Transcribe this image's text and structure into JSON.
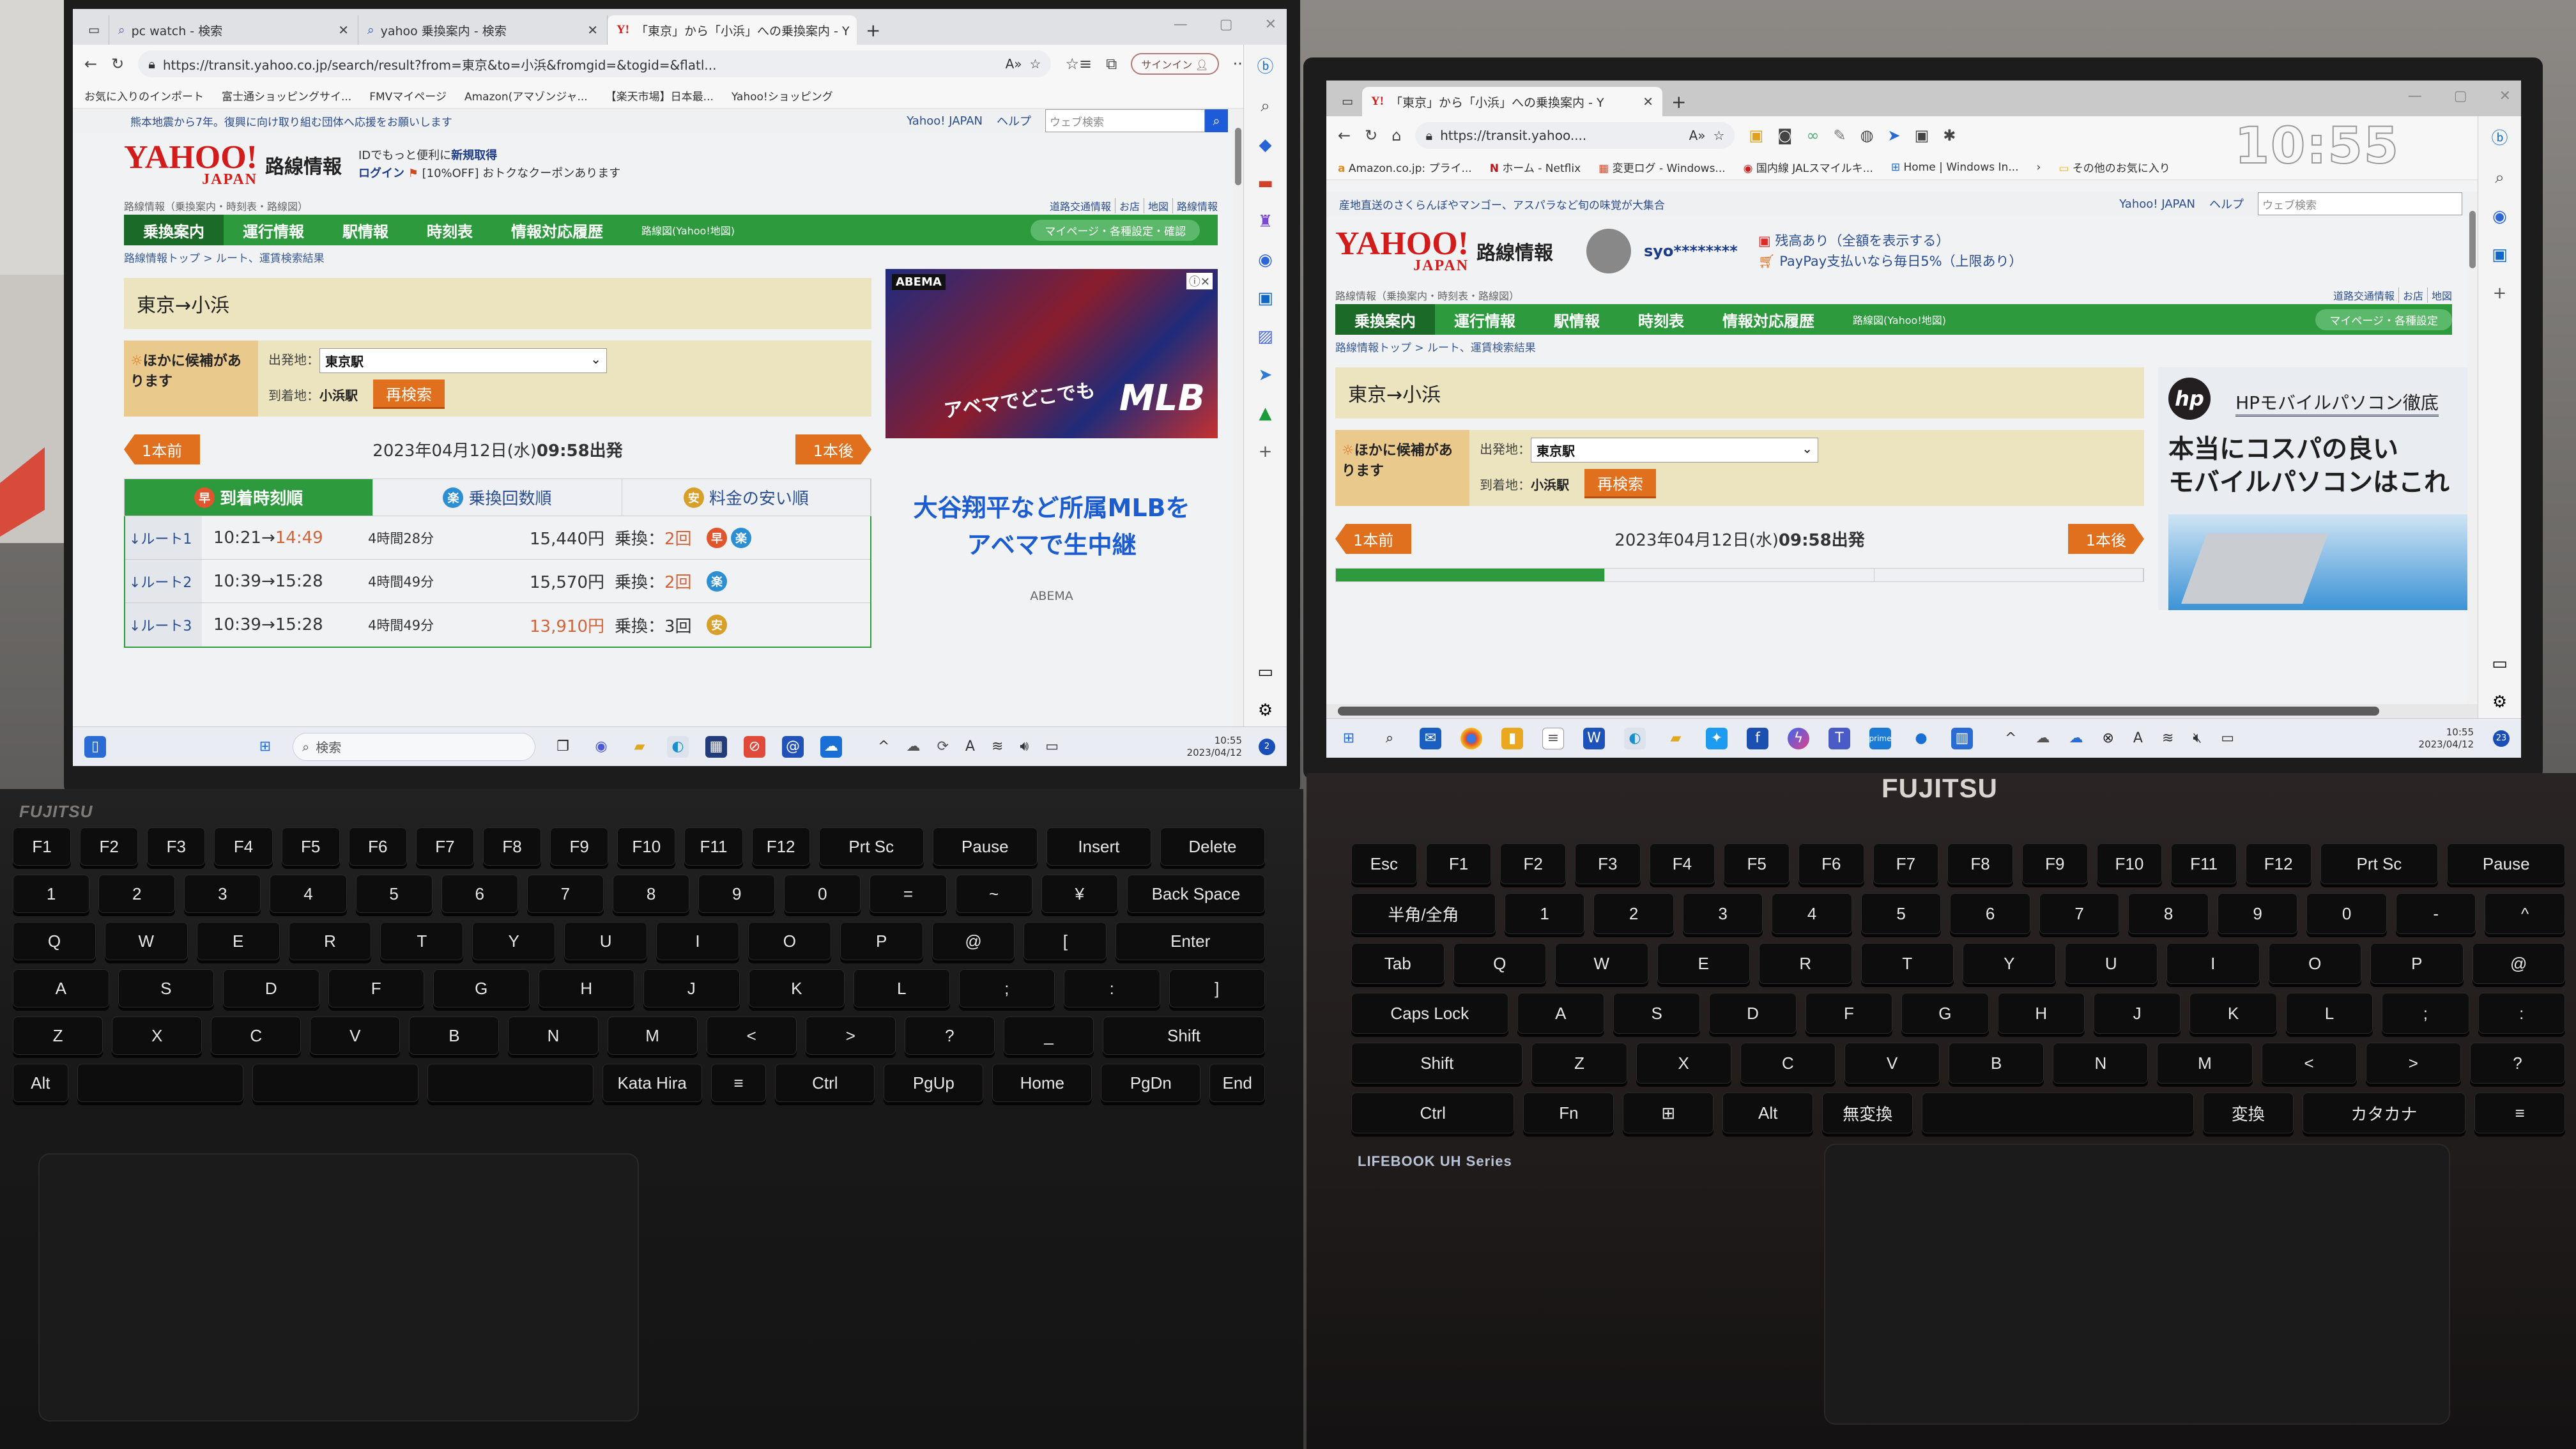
{
  "left_laptop": {
    "brand": "FUJITSU",
    "browser": {
      "tabs": [
        {
          "icon": "search-icon",
          "title": "pc watch - 検索"
        },
        {
          "icon": "search-icon",
          "title": "yahoo 乗換案内 - 検索"
        },
        {
          "icon": "yahoo-icon",
          "title": "「東京」から「小浜」への乗換案内 - Y",
          "active": true
        }
      ],
      "new_tab": "+",
      "address": "https://transit.yahoo.co.jp/search/result?from=東京&to=小浜&fromgid=&togid=&flatl...",
      "signin_label": "サインイン",
      "more": "···",
      "favorites": [
        "お気に入りのインポート",
        "富士通ショッピングサイ...",
        "FMVマイページ",
        "Amazon(アマゾンジャ...",
        "【楽天市場】日本最...",
        "Yahoo!ショッピング"
      ]
    },
    "page": {
      "promo": "熊本地震から7年。復興に向け取り組む団体へ応援をお願いします",
      "top_links": [
        "Yahoo! JAPAN",
        "ヘルプ"
      ],
      "search_placeholder": "ウェブ検索",
      "logo_main": "YAHOO!",
      "logo_sub": "JAPAN",
      "service_name": "路線情報",
      "id_text": "IDでもっと便利に",
      "id_link": "新規取得",
      "login": "ログイン",
      "coupon": "[10%OFF] おトクなクーポンあります",
      "subtitle": "路線情報（乗換案内・時刻表・路線図）",
      "sub_links": [
        "道路交通情報",
        "お店",
        "地図",
        "路線情報"
      ],
      "nav": [
        "乗換案内",
        "運行情報",
        "駅情報",
        "時刻表",
        "情報対応履歴"
      ],
      "nav_small": "路線図(Yahoo!地図)",
      "mypage": "マイページ・各種設定・確認",
      "breadcrumb": "路線情報トップ > ルート、運賃検索結果",
      "route_title": "東京→小浜",
      "candidate_label": "ほかに候補があります",
      "from_label": "出発地：",
      "from_value": "東京駅",
      "to_label": "到着地：",
      "to_value": "小浜駅",
      "research": "再検索",
      "prev": "1本前",
      "next": "1本後",
      "date": "2023年04月12日(水)",
      "dep_time": "09:58出発",
      "sort_tabs": [
        {
          "badge": "早",
          "label": "到着時刻順",
          "active": true
        },
        {
          "badge": "楽",
          "label": "乗換回数順"
        },
        {
          "badge": "安",
          "label": "料金の安い順"
        }
      ],
      "routes": [
        {
          "name": "↓ルート1",
          "dep": "10:21",
          "arr": "14:49",
          "duration": "4時間28分",
          "fare": "15,440円",
          "transfers_label": "乗換：",
          "transfers": "2回",
          "badges": [
            "早",
            "楽"
          ]
        },
        {
          "name": "↓ルート2",
          "dep": "10:39",
          "arr": "15:28",
          "duration": "4時間49分",
          "fare": "15,570円",
          "transfers_label": "乗換：",
          "transfers": "2回",
          "badges": [
            "楽"
          ]
        },
        {
          "name": "↓ルート3",
          "dep": "10:39",
          "arr": "15:28",
          "duration": "4時間49分",
          "fare": "13,910円",
          "transfers_label": "乗換：",
          "transfers": "3回",
          "badges": [
            "安"
          ]
        }
      ],
      "ad": {
        "tag": "ABEMA",
        "catch": "アベマでどこでも",
        "big": "MLB",
        "text": "大谷翔平など所属MLBをアベマで生中継",
        "source": "ABEMA"
      }
    },
    "taskbar": {
      "search": "検索",
      "time": "10:55",
      "date": "2023/04/12",
      "notifications": "2"
    }
  },
  "right_laptop": {
    "brand": "FUJITSU",
    "model": "LIFEBOOK UH Series",
    "overlay_clock": "10:55",
    "browser": {
      "tabs": [
        {
          "icon": "yahoo-icon",
          "title": "「東京」から「小浜」への乗換案内 - Y",
          "active": true
        }
      ],
      "new_tab": "+",
      "address": "https://transit.yahoo....",
      "favorites": [
        "Amazon.co.jp: プライ...",
        "ホーム - Netflix",
        "変更ログ - Windows...",
        "国内線 JALスマイルキ...",
        "Home | Windows In..."
      ],
      "other_favorites": "その他のお気に入り"
    },
    "page": {
      "promo": "産地直送のさくらんぼやマンゴー、アスパラなど旬の味覚が大集合",
      "top_links": [
        "Yahoo! JAPAN",
        "ヘルプ"
      ],
      "search_placeholder": "ウェブ検索",
      "logo_main": "YAHOO!",
      "logo_sub": "JAPAN",
      "service_name": "路線情報",
      "username": "syo********",
      "balance": "残高あり（全額を表示する）",
      "paypay": "PayPay支払いなら毎日5%（上限あり）",
      "subtitle": "路線情報（乗換案内・時刻表・路線図）",
      "sub_links": [
        "道路交通情報",
        "お店",
        "地図"
      ],
      "nav": [
        "乗換案内",
        "運行情報",
        "駅情報",
        "時刻表",
        "情報対応履歴"
      ],
      "nav_small": "路線図(Yahoo!地図)",
      "mypage": "マイページ・各種設定",
      "breadcrumb": "路線情報トップ > ルート、運賃検索結果",
      "route_title": "東京→小浜",
      "candidate_label": "ほかに候補があります",
      "from_label": "出発地：",
      "from_value": "東京駅",
      "to_label": "到着地：",
      "to_value": "小浜駅",
      "research": "再検索",
      "prev": "1本前",
      "next": "1本後",
      "date": "2023年04月12日(水)",
      "dep_time": "09:58出発",
      "ad": {
        "logo": "hp",
        "headline": "HPモバイルパソコン徹底",
        "copy1": "本当にコスパの良い",
        "copy2": "モバイルパソコンはこれ"
      }
    },
    "taskbar": {
      "time": "10:55",
      "date": "2023/04/12",
      "notifications": "23"
    }
  },
  "keyboard_left": {
    "rows": [
      [
        "F1",
        "F2",
        "F3",
        "F4",
        "F5",
        "F6",
        "F7",
        "F8",
        "F9",
        "F10",
        "F11",
        "F12",
        "Prt Sc",
        "Pause",
        "Insert",
        "Delete"
      ],
      [
        "1",
        "2",
        "3",
        "4",
        "5",
        "6",
        "7",
        "8",
        "9",
        "0",
        "=",
        "~",
        "¥",
        "Back Space"
      ],
      [
        "Q",
        "W",
        "E",
        "R",
        "T",
        "Y",
        "U",
        "I",
        "O",
        "P",
        "@",
        "[",
        "Enter"
      ],
      [
        "A",
        "S",
        "D",
        "F",
        "G",
        "H",
        "J",
        "K",
        "L",
        ";",
        ":",
        "]"
      ],
      [
        "Z",
        "X",
        "C",
        "V",
        "B",
        "N",
        "M",
        "<",
        ">",
        "?",
        "_",
        "Shift"
      ],
      [
        "Alt",
        "",
        "",
        "",
        "Kata Hira",
        "≡",
        "Ctrl",
        "PgUp",
        "Home",
        "PgDn",
        "End"
      ]
    ]
  },
  "keyboard_right": {
    "rows": [
      [
        "Esc",
        "F1",
        "F2",
        "F3",
        "F4",
        "F5",
        "F6",
        "F7",
        "F8",
        "F9",
        "F10",
        "F11",
        "F12",
        "Prt Sc",
        "Pause"
      ],
      [
        "半角/全角",
        "1",
        "2",
        "3",
        "4",
        "5",
        "6",
        "7",
        "8",
        "9",
        "0",
        "-",
        "^"
      ],
      [
        "Tab",
        "Q",
        "W",
        "E",
        "R",
        "T",
        "Y",
        "U",
        "I",
        "O",
        "P",
        "@"
      ],
      [
        "Caps Lock",
        "A",
        "S",
        "D",
        "F",
        "G",
        "H",
        "J",
        "K",
        "L",
        ";",
        ":"
      ],
      [
        "Shift",
        "Z",
        "X",
        "C",
        "V",
        "B",
        "N",
        "M",
        "<",
        ">",
        "?"
      ],
      [
        "Ctrl",
        "Fn",
        "⊞",
        "Alt",
        "無変換",
        "",
        "変換",
        "カタカナ",
        "≡"
      ]
    ]
  }
}
